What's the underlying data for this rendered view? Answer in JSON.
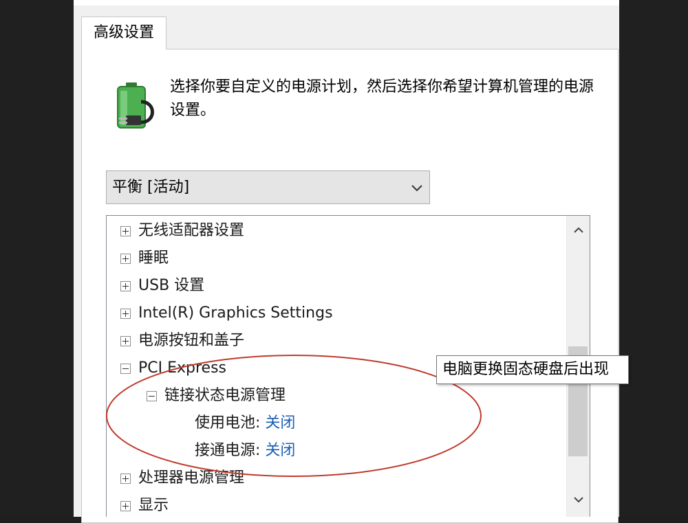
{
  "tab": {
    "label": "高级设置"
  },
  "description": "选择你要自定义的电源计划，然后选择你希望计算机管理的电源设置。",
  "plan_select": {
    "selected": "平衡 [活动]"
  },
  "tree": {
    "items": [
      {
        "label": "无线适配器设置",
        "expanded": false
      },
      {
        "label": "睡眠",
        "expanded": false
      },
      {
        "label": "USB 设置",
        "expanded": false
      },
      {
        "label": "Intel(R) Graphics Settings",
        "expanded": false
      },
      {
        "label": "电源按钮和盖子",
        "expanded": false
      },
      {
        "label": "PCI Express",
        "expanded": true
      },
      {
        "label": "链接状态电源管理",
        "expanded": true
      },
      {
        "label": "使用电池:",
        "value": "关闭"
      },
      {
        "label": "接通电源:",
        "value": "关闭"
      },
      {
        "label": "处理器电源管理",
        "expanded": false
      },
      {
        "label": "显示",
        "expanded": false
      }
    ]
  },
  "tooltip": {
    "text": "电脑更换固态硬盘后出现"
  },
  "colors": {
    "link_value": "#1a5fb4",
    "annotation": "#c0392b",
    "battery_green": "#3cb043"
  },
  "icons": {
    "power_plan": "battery-plug-icon",
    "dropdown": "chevron-down-icon",
    "scroll_up": "chevron-up-icon",
    "scroll_down": "chevron-down-icon"
  }
}
